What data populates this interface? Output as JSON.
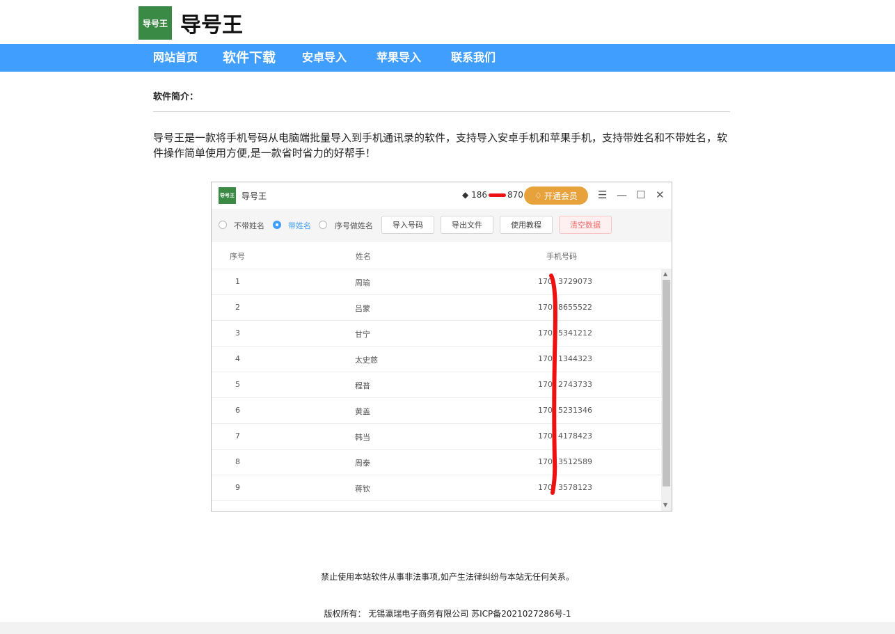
{
  "header": {
    "logo_text": "导号王",
    "title": "导号王"
  },
  "nav": {
    "items": [
      {
        "label": "网站首页"
      },
      {
        "label": "软件下载"
      },
      {
        "label": "安卓导入"
      },
      {
        "label": "苹果导入"
      },
      {
        "label": "联系我们"
      }
    ]
  },
  "intro": {
    "label": "软件简介：",
    "text": "导号王是一款将手机号码从电脑端批量导入到手机通讯录的软件，支持导入安卓手机和苹果手机，支持带姓名和不带姓名，软件操作简单使用方便,是一款省时省力的好帮手！"
  },
  "app": {
    "logo_text": "导号王",
    "title": "导号王",
    "account_prefix": "186",
    "account_suffix": "870",
    "vip_button": "开通会员",
    "window_controls": {
      "menu": "☰",
      "minimize": "—",
      "maximize": "☐",
      "close": "✕"
    },
    "toolbar": {
      "radio_options": [
        {
          "label": "不带姓名",
          "checked": false
        },
        {
          "label": "带姓名",
          "checked": true
        },
        {
          "label": "序号做姓名",
          "checked": false
        }
      ],
      "buttons": [
        "导入号码",
        "导出文件",
        "使用教程",
        "清空数据"
      ]
    },
    "table": {
      "columns": [
        "序号",
        "姓名",
        "手机号码"
      ],
      "rows": [
        {
          "index": "1",
          "name": "周瑜",
          "phone_prefix": "170",
          "phone_suffix": "3729073"
        },
        {
          "index": "2",
          "name": "吕蒙",
          "phone_prefix": "170",
          "phone_suffix": "8655522"
        },
        {
          "index": "3",
          "name": "甘宁",
          "phone_prefix": "170",
          "phone_suffix": "5341212"
        },
        {
          "index": "4",
          "name": "太史慈",
          "phone_prefix": "170",
          "phone_suffix": "1344323"
        },
        {
          "index": "5",
          "name": "程普",
          "phone_prefix": "170",
          "phone_suffix": "2743733"
        },
        {
          "index": "6",
          "name": "黄盖",
          "phone_prefix": "170",
          "phone_suffix": "5231346"
        },
        {
          "index": "7",
          "name": "韩当",
          "phone_prefix": "170",
          "phone_suffix": "4178423"
        },
        {
          "index": "8",
          "name": "周泰",
          "phone_prefix": "170",
          "phone_suffix": "3512589"
        },
        {
          "index": "9",
          "name": "蒋钦",
          "phone_prefix": "170",
          "phone_suffix": "3578123"
        }
      ]
    },
    "redaction_color": "#ee1111"
  },
  "footer": {
    "notice": "禁止使用本站软件从事非法事项,如产生法律纠纷与本站无任何关系。",
    "copyright": "版权所有： 无锡瀛瑞电子商务有限公司 苏ICP备2021027286号-1"
  },
  "colors": {
    "nav_bg": "#409eff",
    "logo_bg": "#3a8a45",
    "vip": "#e8a23b",
    "accent": "#409eff",
    "danger": "#f56c6c"
  }
}
